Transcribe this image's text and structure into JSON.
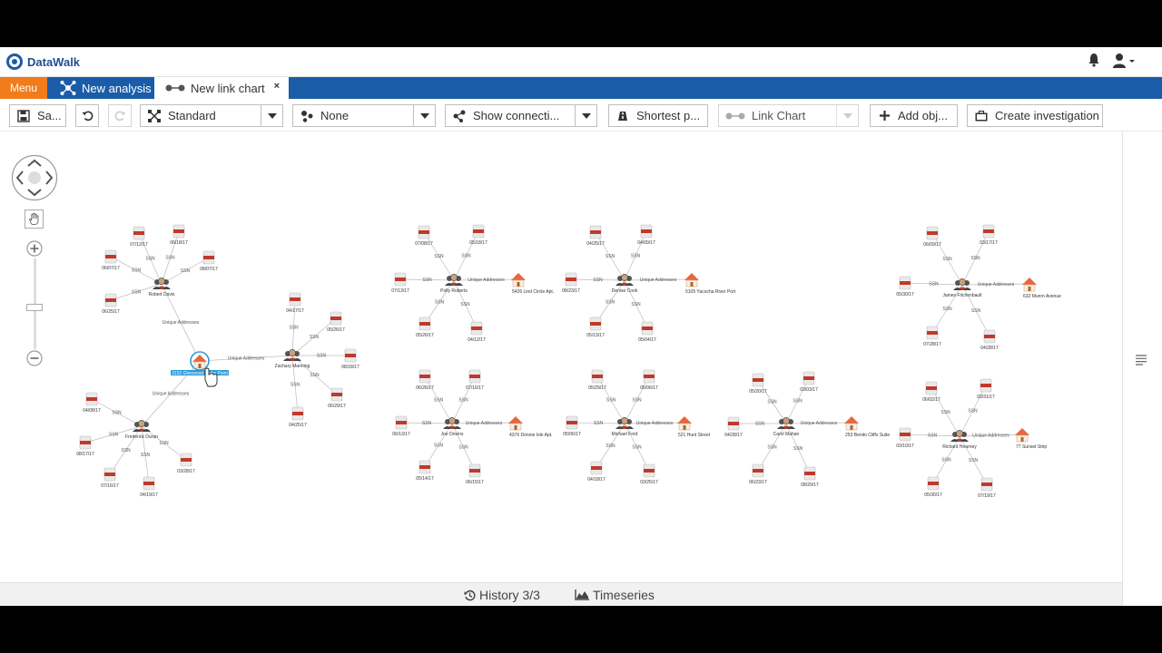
{
  "app": {
    "brand": "DataWalk"
  },
  "tabs": {
    "menu_label": "Menu",
    "analysis_label": "New analysis",
    "linkchart_label": "New link chart",
    "close_glyph": "×"
  },
  "toolbar": {
    "save_label": "Sa...",
    "layout_label": "Standard",
    "group_label": "None",
    "connections_label": "Show connecti...",
    "shortest_label": "Shortest p...",
    "view_label": "Link Chart",
    "add_label": "Add obj...",
    "investigation_label": "Create investigation"
  },
  "bottom": {
    "history_label": "History 3/3",
    "timeseries_label": "Timeseries"
  },
  "colors": {
    "brand_blue": "#1a5ca8",
    "menu_orange": "#f07c1b",
    "selection": "#2a9bd8"
  },
  "icons": [
    "bell-icon",
    "user-icon",
    "network-icon",
    "link-chart-icon",
    "save-icon",
    "undo-icon",
    "redo-icon",
    "layout-icon",
    "group-icon",
    "connections-icon",
    "shortest-path-icon",
    "add-icon",
    "briefcase-icon",
    "history-icon",
    "timeseries-icon",
    "pan-icon",
    "zoom-in-icon",
    "zoom-out-icon",
    "list-icon"
  ],
  "graph": {
    "people": [
      {
        "name": "Robert Davis",
        "ssn": [
          "07/12/17",
          "06/18/17",
          "06/07/17",
          "08/07/17",
          "06/25/17"
        ]
      },
      {
        "name": "Zachary Manning",
        "ssn": [
          "04/17/17",
          "05/26/17",
          "08/18/17",
          "06/29/17",
          "04/25/17"
        ]
      },
      {
        "name": "Frederick Duran",
        "ssn": [
          "04/08/17",
          "08/17/17",
          "07/16/17",
          "04/19/17",
          "03/28/17"
        ]
      },
      {
        "name": "Polly Roberts",
        "ssn": [
          "07/08/17",
          "05/18/17",
          "07/13/17",
          "05/26/17",
          "04/12/17"
        ],
        "address": "5426 Lind Circle Apt."
      },
      {
        "name": "Denise Cook",
        "ssn": [
          "04/25/17",
          "04/09/17",
          "08/23/17",
          "05/13/17",
          "05/04/17"
        ],
        "address": "5105 Yacocha River Port"
      },
      {
        "name": "James Fitchenbault",
        "ssn": [
          "06/09/17",
          "03/17/17",
          "05/30/17",
          "07/28/17",
          "04/28/17"
        ],
        "address": "632 Munro Avenue"
      },
      {
        "name": "Joe Downs",
        "ssn": [
          "06/26/17",
          "07/16/17",
          "06/13/17",
          "05/14/17",
          "06/15/17"
        ],
        "address": "4376 Donnie Isle Apt."
      },
      {
        "name": "Michael Ford",
        "ssn": [
          "05/29/17",
          "05/06/17",
          "05/06/17",
          "04/18/17",
          "03/25/17"
        ],
        "address": "521 Hunt Street"
      },
      {
        "name": "Carol Mahan",
        "ssn": [
          "05/20/17",
          "03/03/17",
          "04/28/17",
          "06/23/17",
          "08/29/17"
        ],
        "address": "253 Benito Cliffs Suite"
      },
      {
        "name": "Richard Hearney",
        "ssn": [
          "06/02/17",
          "03/31/17",
          "03/10/17",
          "05/30/17",
          "07/19/17"
        ],
        "address": "77 Sunset Strip"
      }
    ],
    "edge_ssn": "SSN",
    "edge_address": "Unique Addresses",
    "selected_address": "3152 Glenwood Forks Point"
  }
}
